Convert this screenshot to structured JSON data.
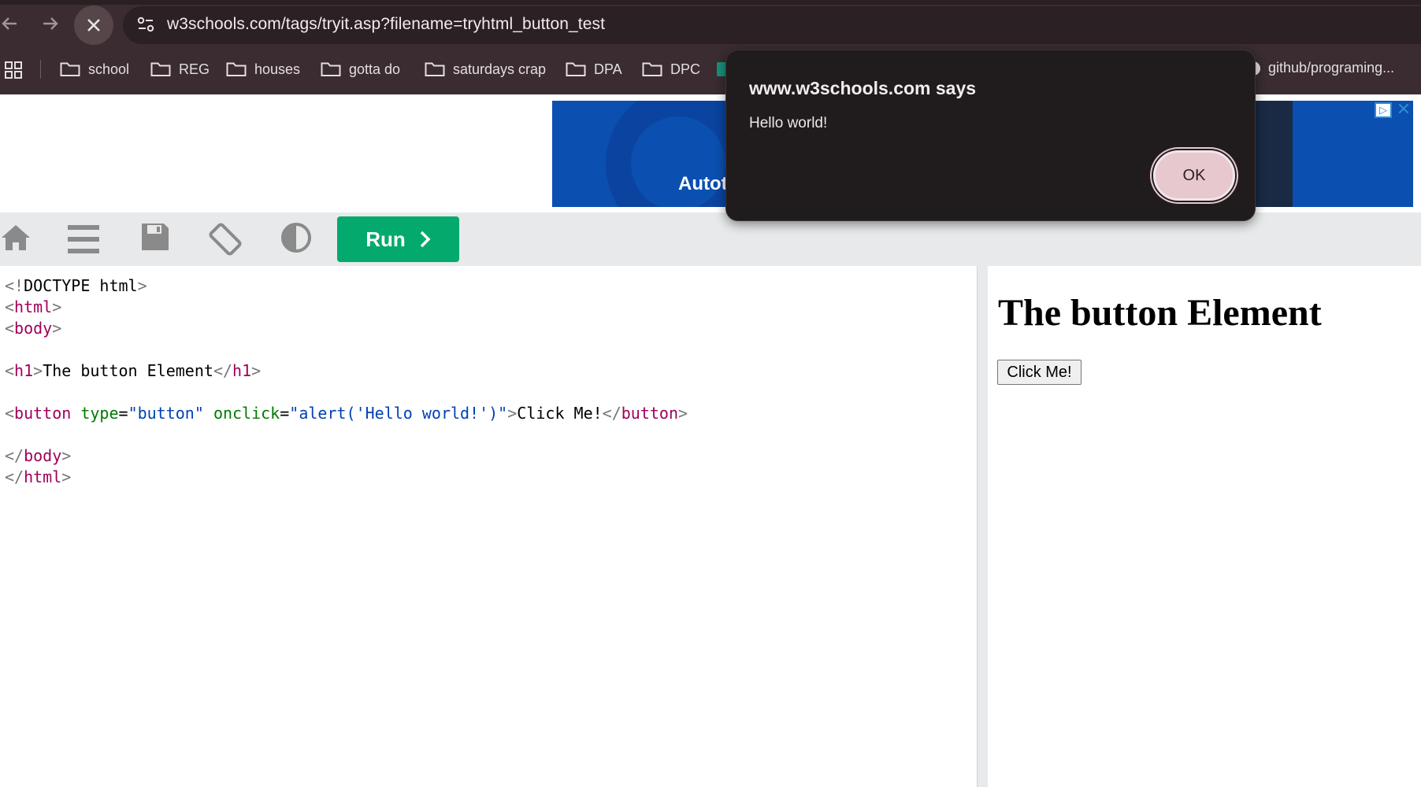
{
  "browser": {
    "url": "w3schools.com/tags/tryit.asp?filename=tryhtml_button_test",
    "bookmarks": [
      {
        "label": "school"
      },
      {
        "label": "REG"
      },
      {
        "label": "houses"
      },
      {
        "label": "gotta do"
      },
      {
        "label": "saturdays crap"
      },
      {
        "label": "DPA"
      },
      {
        "label": "DPC"
      }
    ],
    "bookmark_overflow_label": "github/programing...",
    "icons": {
      "back": "arrow-left-icon",
      "forward": "arrow-right-icon",
      "reload": "close-icon",
      "site_settings": "tune-icon",
      "apps": "apps-grid-icon",
      "bookmark_folder": "folder-icon"
    }
  },
  "ad": {
    "text": "Autotr"
  },
  "toolbar": {
    "run_label": "Run",
    "icons": [
      "home-icon",
      "menu-icon",
      "save-icon",
      "rotate-icon",
      "contrast-icon"
    ]
  },
  "editor": {
    "code_lines": [
      "<!DOCTYPE html>",
      "<html>",
      "<body>",
      "",
      "<h1>The button Element</h1>",
      "",
      "<button type=\"button\" onclick=\"alert('Hello world!')\">Click Me!</button>",
      "",
      "</body>",
      "</html>"
    ]
  },
  "result": {
    "heading": "The button Element",
    "button_label": "Click Me!"
  },
  "alert": {
    "title": "www.w3schools.com says",
    "message": "Hello world!",
    "ok_label": "OK"
  },
  "colors": {
    "chrome_bg": "#3a2c30",
    "run_green": "#04aa6d",
    "alert_bg": "#201c1d",
    "ok_pink": "#e7c8cf"
  }
}
